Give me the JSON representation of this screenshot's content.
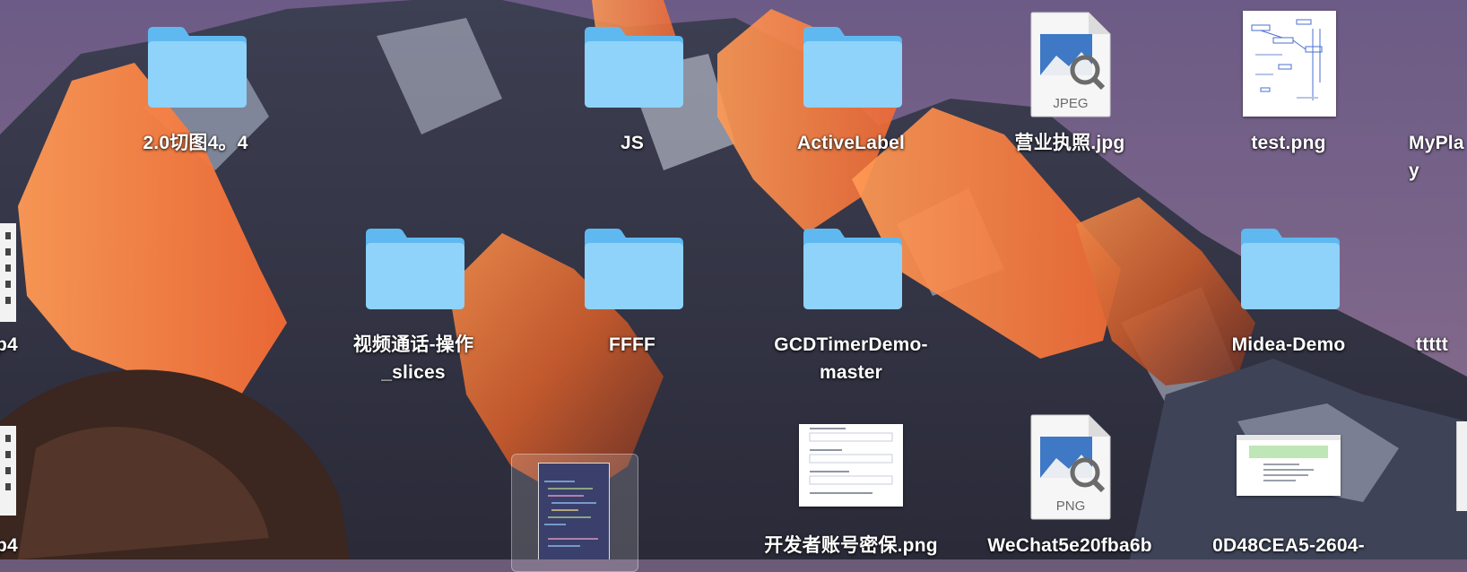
{
  "desktop": {
    "items": [
      {
        "id": "folder-2-0",
        "type": "folder",
        "label": "2.0切图4。4"
      },
      {
        "id": "folder-js",
        "type": "folder",
        "label": "JS"
      },
      {
        "id": "folder-activelabel",
        "type": "folder",
        "label": "ActiveLabel"
      },
      {
        "id": "file-license-jpg",
        "type": "jpeg-file",
        "label": "营业执照.jpg",
        "badge": "JPEG"
      },
      {
        "id": "file-test-png",
        "type": "image-thumbnail",
        "label": "test.png"
      },
      {
        "id": "file-myplay",
        "type": "partial",
        "label": "MyPla\ny"
      },
      {
        "id": "file-mp4-1",
        "type": "partial",
        "label": "p4"
      },
      {
        "id": "folder-video-slices",
        "type": "folder",
        "label": "视频通话-操作\n_slices"
      },
      {
        "id": "folder-ffff",
        "type": "folder",
        "label": "FFFF"
      },
      {
        "id": "folder-gcdtimer",
        "type": "folder",
        "label": "GCDTimerDemo-\nmaster"
      },
      {
        "id": "folder-midea",
        "type": "folder",
        "label": "Midea-Demo"
      },
      {
        "id": "file-tttt",
        "type": "partial",
        "label": "ttttt"
      },
      {
        "id": "file-mp4-2",
        "type": "partial",
        "label": "p4"
      },
      {
        "id": "file-dev-account-png",
        "type": "image-thumbnail",
        "label": "开发者账号密保.png"
      },
      {
        "id": "file-wechat-png",
        "type": "png-file",
        "label": "WeChat5e20fba6b",
        "badge": "PNG"
      },
      {
        "id": "file-0d48-png",
        "type": "image-thumbnail",
        "label": "0D48CEA5-2604-"
      }
    ]
  },
  "colors": {
    "folder_light": "#8fd3fb",
    "folder_dark": "#5fb9f0",
    "label_text": "#ffffff"
  }
}
